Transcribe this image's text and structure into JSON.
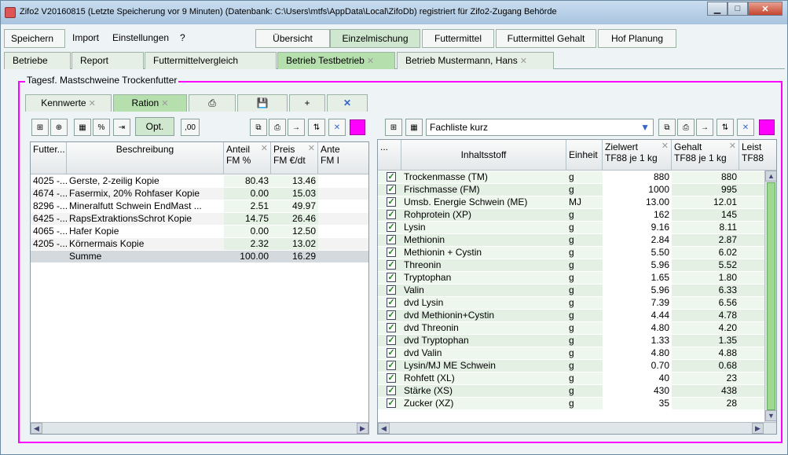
{
  "window": {
    "title": "Zifo2 V20160815 (Letzte Speicherung vor 9 Minuten) (Datenbank: C:\\Users\\mtfs\\AppData\\Local\\ZifoDb) registriert für Zifo2-Zugang Behörde"
  },
  "menu": {
    "save": "Speichern",
    "import": "Import",
    "settings": "Einstellungen",
    "help": "?",
    "overview": "Übersicht",
    "mix": "Einzelmischung",
    "feed": "Futtermittel",
    "feed_content": "Futtermittel Gehalt",
    "farm": "Hof Planung"
  },
  "tabs": [
    "Betriebe",
    "Report",
    "Futtermittelvergleich",
    "Betrieb Testbetrieb",
    "Betrieb Mustermann, Hans"
  ],
  "panel": {
    "label": "Tagesf. Mastschweine Trockenfutter"
  },
  "subtabs": {
    "kennwerte": "Kennwerte",
    "ration": "Ration",
    "plus": "+"
  },
  "left_toolbar": {
    "opt": "Opt.",
    "decimals": ",00"
  },
  "left_table": {
    "headers": [
      "Futter...",
      "Beschreibung",
      "Anteil",
      "FM %",
      "Preis",
      "FM €/dt",
      "Ante",
      "FM I"
    ],
    "rows": [
      [
        "4025 -...",
        "Gerste, 2-zeilig Kopie",
        "80.43",
        "13.46"
      ],
      [
        "4674 -...",
        "Fasermix, 20% Rohfaser Kopie",
        "0.00",
        "15.03"
      ],
      [
        "8296 -...",
        "Mineralfutt Schwein EndMast ...",
        "2.51",
        "49.97"
      ],
      [
        "6425 -...",
        "RapsExtraktionsSchrot Kopie",
        "14.75",
        "26.46"
      ],
      [
        "4065 -...",
        "Hafer Kopie",
        "0.00",
        "12.50"
      ],
      [
        "4205 -...",
        "Körnermais Kopie",
        "2.32",
        "13.02"
      ],
      [
        "",
        "Summe",
        "100.00",
        "16.29"
      ]
    ]
  },
  "right_toolbar": {
    "list": "Fachliste kurz"
  },
  "right_table": {
    "headers": [
      "...",
      "Inhaltsstoff",
      "Einheit",
      "Zielwert",
      "TF88 je 1 kg",
      "Gehalt",
      "TF88 je 1 kg",
      "Leist",
      "TF88"
    ],
    "rows": [
      [
        "Trockenmasse (TM)",
        "g",
        "880",
        "880"
      ],
      [
        "Frischmasse (FM)",
        "g",
        "1000",
        "995"
      ],
      [
        "Umsb. Energie Schwein (ME)",
        "MJ",
        "13.00",
        "12.01"
      ],
      [
        "Rohprotein (XP)",
        "g",
        "162",
        "145"
      ],
      [
        "Lysin",
        "g",
        "9.16",
        "8.11"
      ],
      [
        "Methionin",
        "g",
        "2.84",
        "2.87"
      ],
      [
        "Methionin + Cystin",
        "g",
        "5.50",
        "6.02"
      ],
      [
        "Threonin",
        "g",
        "5.96",
        "5.52"
      ],
      [
        "Tryptophan",
        "g",
        "1.65",
        "1.80"
      ],
      [
        "Valin",
        "g",
        "5.96",
        "6.33"
      ],
      [
        "dvd Lysin",
        "g",
        "7.39",
        "6.56"
      ],
      [
        "dvd Methionin+Cystin",
        "g",
        "4.44",
        "4.78"
      ],
      [
        "dvd Threonin",
        "g",
        "4.80",
        "4.20"
      ],
      [
        "dvd Tryptophan",
        "g",
        "1.33",
        "1.35"
      ],
      [
        "dvd Valin",
        "g",
        "4.80",
        "4.88"
      ],
      [
        "Lysin/MJ ME Schwein",
        "g",
        "0.70",
        "0.68"
      ],
      [
        "Rohfett (XL)",
        "g",
        "40",
        "23"
      ],
      [
        "Stärke (XS)",
        "g",
        "430",
        "438"
      ],
      [
        "Zucker (XZ)",
        "g",
        "35",
        "28"
      ]
    ]
  },
  "colors": {
    "highlight": "#ff00ff",
    "active_tab": "#b6dfae"
  }
}
